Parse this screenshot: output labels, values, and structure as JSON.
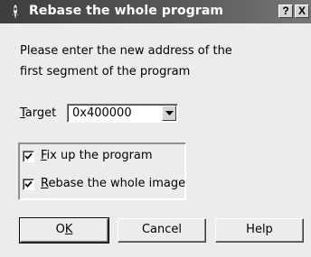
{
  "window": {
    "title": "Rebase the whole program",
    "help_glyph": "?",
    "close_glyph": "X",
    "app_icon": "rocket-icon"
  },
  "message": {
    "line1": "Please enter the new address of the",
    "line2": "first segment of the program"
  },
  "target": {
    "label_underlined": "T",
    "label_rest": "arget",
    "value": "0x400000"
  },
  "options": [
    {
      "underlined": "F",
      "rest": "ix up the program",
      "checked": true
    },
    {
      "underlined": "R",
      "rest": "ebase the whole image",
      "checked": true
    }
  ],
  "buttons": {
    "ok_pre": "O",
    "ok_underlined": "K",
    "cancel": "Cancel",
    "help": "Help"
  }
}
